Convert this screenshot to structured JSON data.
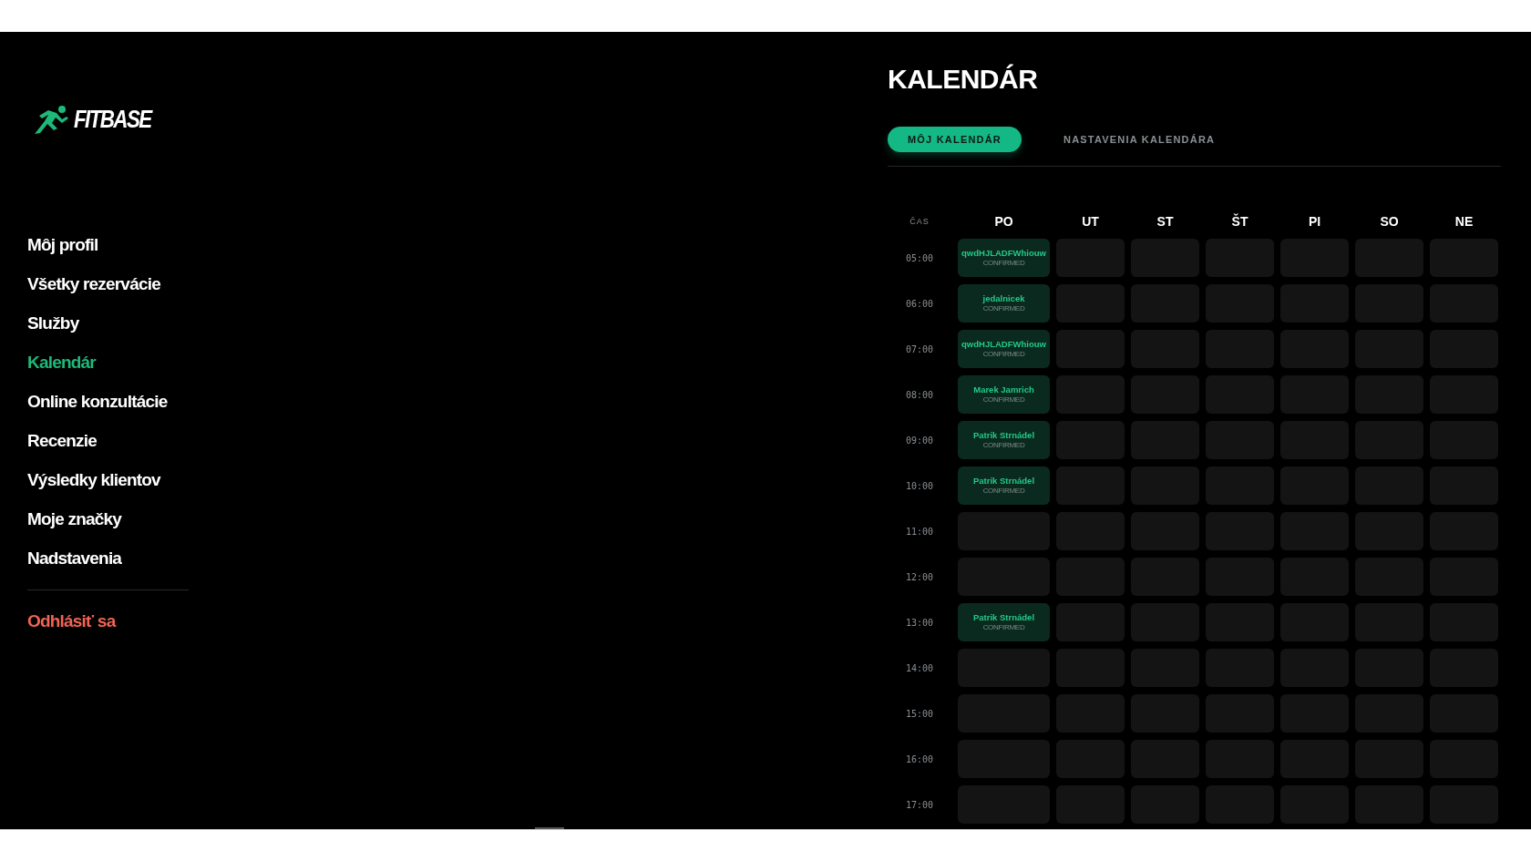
{
  "sidebar": {
    "logo": "FITBASE",
    "items": [
      {
        "label": "Môj profil",
        "selected": false
      },
      {
        "label": "Všetky rezervácie",
        "selected": false
      },
      {
        "label": "Služby",
        "selected": false
      },
      {
        "label": "Kalendár",
        "selected": true
      },
      {
        "label": "Online konzultácie",
        "selected": false
      },
      {
        "label": "Recenzie",
        "selected": false
      },
      {
        "label": "Výsledky klientov",
        "selected": false
      },
      {
        "label": "Moje značky",
        "selected": false
      },
      {
        "label": "Nadstavenia",
        "selected": false
      }
    ],
    "logout": "Odhlásiť sa"
  },
  "page": {
    "title": "KALENDÁR",
    "tabs": [
      {
        "label": "MÔJ KALENDÁR",
        "selected": true
      },
      {
        "label": "NASTAVENIA KALENDÁRA",
        "selected": false
      }
    ]
  },
  "calendar": {
    "time_header": "ČAS",
    "days": [
      "PO",
      "UT",
      "ST",
      "ŠT",
      "PI",
      "SO",
      "NE"
    ],
    "rows": [
      {
        "time": "05:00",
        "cells": [
          {
            "kind": "event",
            "title": "qwdHJLADFWhiouw",
            "status": "CONFIRMED"
          },
          {
            "kind": "empty"
          },
          {
            "kind": "empty"
          },
          {
            "kind": "empty"
          },
          {
            "kind": "empty"
          },
          {
            "kind": "empty"
          },
          {
            "kind": "empty"
          }
        ]
      },
      {
        "time": "06:00",
        "cells": [
          {
            "kind": "event",
            "title": "jedalnicek",
            "status": "CONFIRMED"
          },
          {
            "kind": "empty"
          },
          {
            "kind": "empty"
          },
          {
            "kind": "empty"
          },
          {
            "kind": "empty"
          },
          {
            "kind": "empty"
          },
          {
            "kind": "empty"
          }
        ]
      },
      {
        "time": "07:00",
        "cells": [
          {
            "kind": "event",
            "title": "qwdHJLADFWhiouw",
            "status": "CONFIRMED"
          },
          {
            "kind": "empty"
          },
          {
            "kind": "empty"
          },
          {
            "kind": "empty"
          },
          {
            "kind": "empty"
          },
          {
            "kind": "empty"
          },
          {
            "kind": "empty"
          }
        ]
      },
      {
        "time": "08:00",
        "cells": [
          {
            "kind": "event",
            "title": "Marek Jamrich",
            "status": "CONFIRMED"
          },
          {
            "kind": "empty"
          },
          {
            "kind": "empty"
          },
          {
            "kind": "empty"
          },
          {
            "kind": "empty"
          },
          {
            "kind": "empty"
          },
          {
            "kind": "empty"
          }
        ]
      },
      {
        "time": "09:00",
        "cells": [
          {
            "kind": "event",
            "title": "Patrik Strnádel",
            "status": "CONFIRMED"
          },
          {
            "kind": "empty"
          },
          {
            "kind": "empty"
          },
          {
            "kind": "empty"
          },
          {
            "kind": "empty"
          },
          {
            "kind": "empty"
          },
          {
            "kind": "empty"
          }
        ]
      },
      {
        "time": "10:00",
        "cells": [
          {
            "kind": "event",
            "title": "Patrik Strnádel",
            "status": "CONFIRMED"
          },
          {
            "kind": "empty"
          },
          {
            "kind": "empty"
          },
          {
            "kind": "empty"
          },
          {
            "kind": "empty"
          },
          {
            "kind": "empty"
          },
          {
            "kind": "empty"
          }
        ]
      },
      {
        "time": "11:00",
        "cells": [
          {
            "kind": "empty"
          },
          {
            "kind": "empty"
          },
          {
            "kind": "empty"
          },
          {
            "kind": "empty"
          },
          {
            "kind": "empty"
          },
          {
            "kind": "empty"
          },
          {
            "kind": "empty"
          }
        ]
      },
      {
        "time": "12:00",
        "cells": [
          {
            "kind": "empty"
          },
          {
            "kind": "empty"
          },
          {
            "kind": "empty"
          },
          {
            "kind": "empty"
          },
          {
            "kind": "empty"
          },
          {
            "kind": "empty"
          },
          {
            "kind": "empty"
          }
        ]
      },
      {
        "time": "13:00",
        "cells": [
          {
            "kind": "event",
            "title": "Patrik Strnádel",
            "status": "CONFIRMED"
          },
          {
            "kind": "empty"
          },
          {
            "kind": "empty"
          },
          {
            "kind": "empty"
          },
          {
            "kind": "empty"
          },
          {
            "kind": "empty"
          },
          {
            "kind": "empty"
          }
        ]
      },
      {
        "time": "14:00",
        "cells": [
          {
            "kind": "empty"
          },
          {
            "kind": "empty"
          },
          {
            "kind": "empty"
          },
          {
            "kind": "empty"
          },
          {
            "kind": "empty"
          },
          {
            "kind": "empty"
          },
          {
            "kind": "empty"
          }
        ]
      },
      {
        "time": "15:00",
        "cells": [
          {
            "kind": "empty"
          },
          {
            "kind": "empty"
          },
          {
            "kind": "empty"
          },
          {
            "kind": "empty"
          },
          {
            "kind": "empty"
          },
          {
            "kind": "empty"
          },
          {
            "kind": "empty"
          }
        ]
      },
      {
        "time": "16:00",
        "cells": [
          {
            "kind": "empty"
          },
          {
            "kind": "empty"
          },
          {
            "kind": "empty"
          },
          {
            "kind": "empty"
          },
          {
            "kind": "empty"
          },
          {
            "kind": "empty"
          },
          {
            "kind": "empty"
          }
        ]
      },
      {
        "time": "17:00",
        "cells": [
          {
            "kind": "empty"
          },
          {
            "kind": "empty"
          },
          {
            "kind": "empty"
          },
          {
            "kind": "empty"
          },
          {
            "kind": "empty"
          },
          {
            "kind": "empty"
          },
          {
            "kind": "empty"
          }
        ]
      }
    ]
  }
}
